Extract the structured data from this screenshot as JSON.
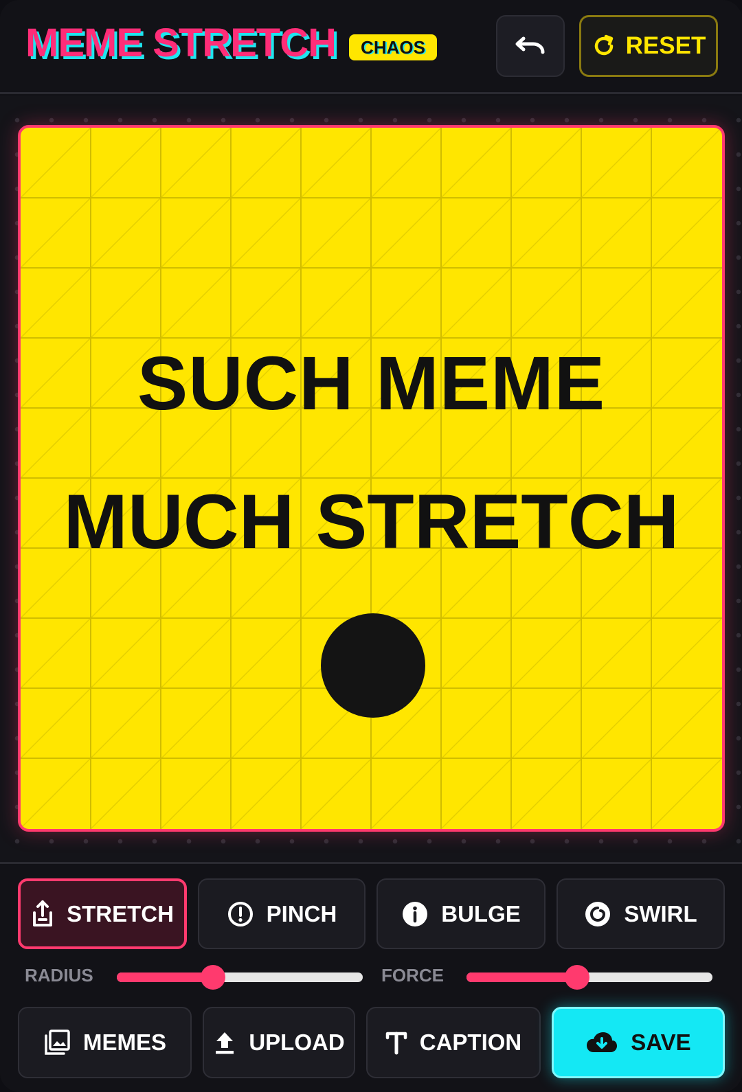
{
  "header": {
    "title": "MEME STRETCH",
    "badge": "CHAOS",
    "undo_icon": "undo-icon",
    "reset_label": "RESET",
    "reset_icon": "refresh-icon"
  },
  "canvas": {
    "line1": "SUCH MEME",
    "line2": "MUCH STRETCH",
    "background_color": "#ffe600",
    "border_color": "#ff3a6e"
  },
  "tools": [
    {
      "label": "STRETCH",
      "icon": "stretch-icon",
      "active": true
    },
    {
      "label": "PINCH",
      "icon": "pinch-icon",
      "active": false
    },
    {
      "label": "BULGE",
      "icon": "bulge-icon",
      "active": false
    },
    {
      "label": "SWIRL",
      "icon": "swirl-icon",
      "active": false
    }
  ],
  "sliders": {
    "radius": {
      "label": "RADIUS",
      "value": 0.39
    },
    "force": {
      "label": "FORCE",
      "value": 0.45
    }
  },
  "actions": [
    {
      "label": "MEMES",
      "icon": "gallery-icon"
    },
    {
      "label": "UPLOAD",
      "icon": "upload-icon"
    },
    {
      "label": "CAPTION",
      "icon": "text-icon"
    },
    {
      "label": "SAVE",
      "icon": "cloud-download-icon"
    }
  ],
  "colors": {
    "accent_pink": "#ff3a6e",
    "accent_cyan": "#14e8f4",
    "accent_yellow": "#ffe600"
  }
}
